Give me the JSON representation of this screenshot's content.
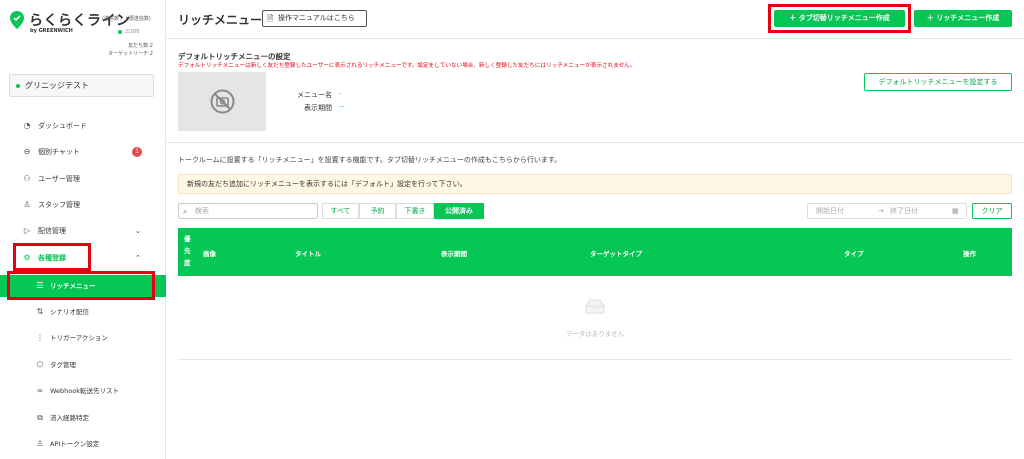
{
  "brand": {
    "name": "らくらくライン",
    "sub": "(送信数 / 上限送信数)",
    "by": "by GREENWICH",
    "plan": "2/200"
  },
  "stats": {
    "friends": "友だち数:2",
    "target": "ターゲットリーチ:2"
  },
  "account": {
    "name": "グリニッジテスト"
  },
  "nav": {
    "dashboard": "ダッシュボード",
    "chat": "個別チャット",
    "chat_badge": "1",
    "users": "ユーザー管理",
    "staff": "スタッフ管理",
    "delivery": "配信管理",
    "registration": "各種登録",
    "richmenu": "リッチメニュー",
    "scenario": "シナリオ配信",
    "trigger": "トリガーアクション",
    "tags": "タグ管理",
    "webhook": "Webhook転送先リスト",
    "route": "流入経路特定",
    "api": "APIトークン設定"
  },
  "header": {
    "title": "リッチメニュー",
    "manual": "操作マニュアルはこちら",
    "tab_create": "タブ切替リッチメニュー作成",
    "create": "リッチメニュー作成"
  },
  "default_section": {
    "title": "デフォルトリッチメニューの設定",
    "note": "デフォルトリッチメニューは新しく友だち登録したユーザーに表示されるリッチメニューです。設定をしていない場合、新しく登録した友だちにはリッチメニューが表示されません。",
    "menu_name_label": "メニュー名",
    "menu_name_value": "-",
    "period_label": "表示期間",
    "period_value": "--",
    "set_button": "デフォルトリッチメニューを設定する"
  },
  "description": "トークルームに設置する「リッチメニュー」を設置する機能です。タブ切替リッチメニューの作成もこちらから行います。",
  "notice": "新規の友だち追加にリッチメニューを表示するには「デフォルト」設定を行って下さい。",
  "filters": {
    "search_placeholder": "検索",
    "tabs": [
      "すべて",
      "予約",
      "下書き",
      "公開済み"
    ],
    "start_date": "開始日付",
    "arrow": "→",
    "end_date": "終了日付",
    "clear": "クリア"
  },
  "table": {
    "columns": [
      "優先度",
      "画像",
      "タイトル",
      "表示期間",
      "ターゲットタイプ",
      "タイプ",
      "操作"
    ],
    "empty": "データはありません"
  },
  "colors": {
    "accent": "#06c755",
    "highlight": "#e60012",
    "badge": "#e84848"
  }
}
